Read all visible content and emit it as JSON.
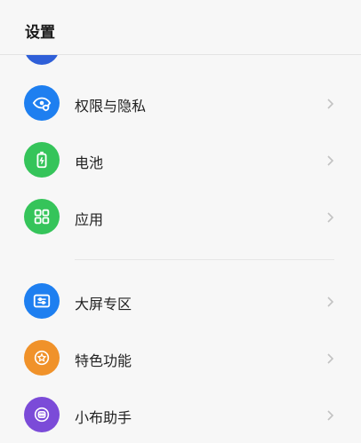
{
  "header": {
    "title": "设置"
  },
  "colors": {
    "blue": "#1e7ff0",
    "green": "#35c45a",
    "orange": "#f0922a",
    "purple": "#7b4bd8",
    "partial": "#2f5fd8"
  },
  "items": [
    {
      "label": "权限与隐私",
      "icon": "eye-shield-icon"
    },
    {
      "label": "电池",
      "icon": "battery-icon"
    },
    {
      "label": "应用",
      "icon": "apps-grid-icon"
    },
    {
      "label": "大屏专区",
      "icon": "large-screen-icon"
    },
    {
      "label": "特色功能",
      "icon": "star-icon"
    },
    {
      "label": "小布助手",
      "icon": "assistant-icon"
    }
  ]
}
